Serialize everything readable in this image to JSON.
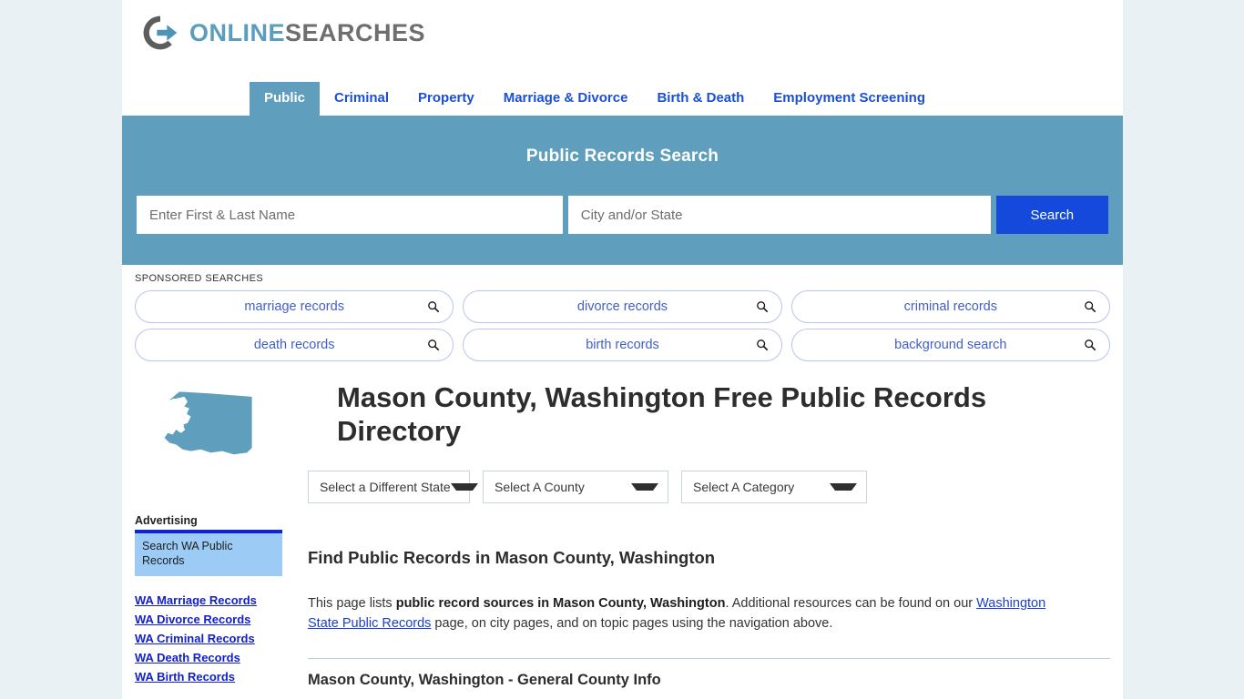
{
  "brand": {
    "name_part1": "ONLINE",
    "name_part2": "SEARCHES",
    "logo_icon": "circle-arrow-logo",
    "accent_blue": "#5b9dbd",
    "accent_gray": "#6e6e6e"
  },
  "nav": {
    "tabs": [
      {
        "label": "Public",
        "active": true
      },
      {
        "label": "Criminal",
        "active": false
      },
      {
        "label": "Property",
        "active": false
      },
      {
        "label": "Marriage & Divorce",
        "active": false
      },
      {
        "label": "Birth & Death",
        "active": false
      },
      {
        "label": "Employment Screening",
        "active": false
      }
    ],
    "active_bg": "#5f9fbd",
    "link_color": "#1a4fd6"
  },
  "banner": {
    "title": "Public Records Search",
    "background": "#5f9fbd",
    "name_placeholder": "Enter First & Last Name",
    "name_value": "",
    "place_placeholder": "City and/or State",
    "place_value": "",
    "search_label": "Search",
    "search_button_color": "#1449dc"
  },
  "sponsored": {
    "label": "SPONSORED SEARCHES",
    "icon": "search-icon",
    "items": [
      {
        "label": "marriage records"
      },
      {
        "label": "divorce records"
      },
      {
        "label": "criminal records"
      },
      {
        "label": "death records"
      },
      {
        "label": "birth records"
      },
      {
        "label": "background search"
      }
    ]
  },
  "hero": {
    "state_map_icon": "washington-state-map-icon",
    "state_map_color": "#5f9fbd",
    "title": "Mason County, Washington Free Public Records Directory"
  },
  "selects": [
    {
      "label": "Select a Different State",
      "icon": "chevron-down-icon"
    },
    {
      "label": "Select A County",
      "icon": "chevron-down-icon"
    },
    {
      "label": "Select A Category",
      "icon": "chevron-down-icon"
    }
  ],
  "main": {
    "heading": "Find Public Records in Mason County, Washington",
    "intro_part1": "This page lists ",
    "intro_bold": "public record sources in Mason County, Washington",
    "intro_part2": ". Additional resources can be found on our ",
    "intro_link": "Washington State Public Records",
    "intro_part3": " page, on city pages, and on topic pages using the navigation above.",
    "section_heading": "Mason County, Washington - General County Info"
  },
  "sidebar": {
    "advertising_label": "Advertising",
    "ad_box_text": "Search WA Public Records",
    "ad_box_color": "#9ccbf6",
    "ad_bar_color": "#1126c6",
    "links": [
      {
        "label": "WA Marriage Records"
      },
      {
        "label": "WA Divorce Records"
      },
      {
        "label": "WA Criminal Records"
      },
      {
        "label": "WA Death Records"
      },
      {
        "label": "WA Birth Records"
      }
    ]
  }
}
